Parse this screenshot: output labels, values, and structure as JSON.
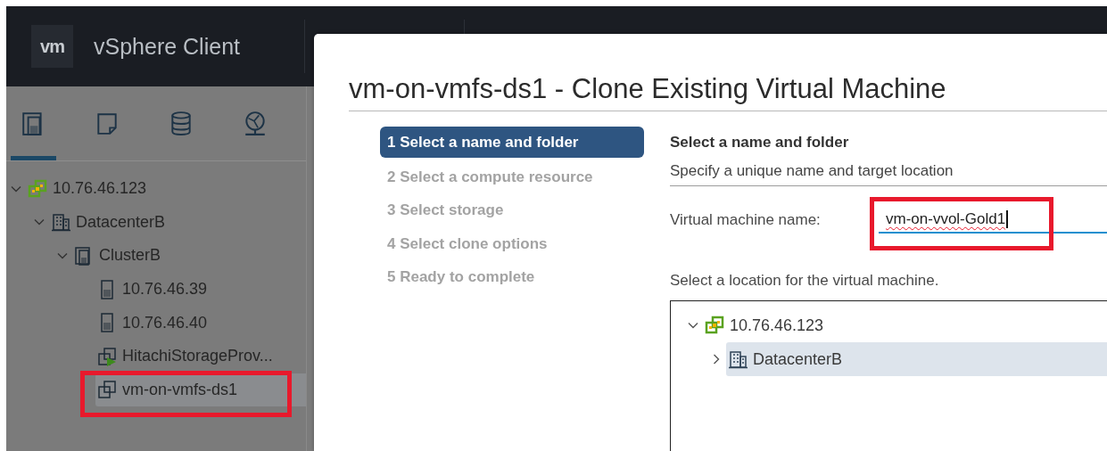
{
  "header": {
    "logo": "vm",
    "title": "vSphere Client"
  },
  "sidebar": {
    "tabs": [
      {
        "kind": "hosts",
        "selected": true
      },
      {
        "kind": "vms",
        "selected": false
      },
      {
        "kind": "storage",
        "selected": false
      },
      {
        "kind": "network",
        "selected": false
      }
    ],
    "tree": [
      {
        "label": "10.76.46.123",
        "kind": "vcenter",
        "expanded": true,
        "selected": false,
        "children": [
          {
            "label": "DatacenterB",
            "kind": "datacenter",
            "expanded": true,
            "selected": false,
            "children": [
              {
                "label": "ClusterB",
                "kind": "cluster",
                "expanded": true,
                "selected": false,
                "children": [
                  {
                    "label": "10.76.46.39",
                    "kind": "host",
                    "selected": false
                  },
                  {
                    "label": "10.76.46.40",
                    "kind": "host",
                    "selected": false
                  },
                  {
                    "label": "HitachiStorageProv...",
                    "kind": "vm-running",
                    "selected": false
                  },
                  {
                    "label": "vm-on-vmfs-ds1",
                    "kind": "vm",
                    "selected": true,
                    "highlighted": true
                  }
                ]
              }
            ]
          }
        ]
      }
    ]
  },
  "dialog": {
    "title": "vm-on-vmfs-ds1 - Clone Existing Virtual Machine",
    "steps": [
      {
        "label": "1 Select a name and folder",
        "selected": true
      },
      {
        "label": "2 Select a compute resource",
        "selected": false
      },
      {
        "label": "3 Select storage",
        "selected": false
      },
      {
        "label": "4 Select clone options",
        "selected": false
      },
      {
        "label": "5 Ready to complete",
        "selected": false
      }
    ],
    "section_title": "Select a name and folder",
    "section_subtitle": "Specify a unique name and target location",
    "name_field": {
      "label": "Virtual machine name:",
      "value": "vm-on-vvol-Gold1",
      "focused": true,
      "misspelled": true,
      "highlighted": true
    },
    "location_label": "Select a location for the virtual machine.",
    "location_tree": [
      {
        "label": "10.76.46.123",
        "kind": "vcenter",
        "expanded": true,
        "selected": false,
        "children": [
          {
            "label": "DatacenterB",
            "kind": "datacenter",
            "expanded": false,
            "selected": true
          }
        ]
      }
    ]
  }
}
